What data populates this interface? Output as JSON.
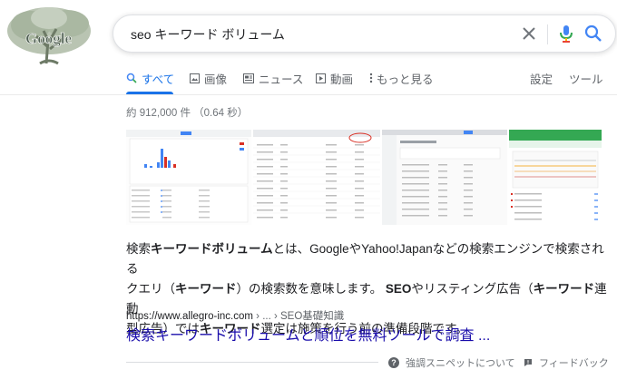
{
  "search": {
    "query": "seo キーワード ボリューム"
  },
  "logo": {
    "text": "Google"
  },
  "tabs": [
    {
      "label": "すべて",
      "icon": "search-icon"
    },
    {
      "label": "画像",
      "icon": "image-icon"
    },
    {
      "label": "ニュース",
      "icon": "news-icon"
    },
    {
      "label": "動画",
      "icon": "video-icon"
    },
    {
      "label": "もっと見る",
      "icon": "more-vert-icon"
    }
  ],
  "right_tabs": {
    "settings": "設定",
    "tools": "ツール"
  },
  "result_stats": "約 912,000 件 （0.64 秒）",
  "snippet_parts": [
    {
      "t": "検索",
      "b": false
    },
    {
      "t": "キーワードボリューム",
      "b": true
    },
    {
      "t": "とは、GoogleやYahoo!Japanなどの検索エンジンで検索される",
      "b": false
    },
    {
      "t": "クエリ（",
      "b": false
    },
    {
      "t": "キーワード",
      "b": true
    },
    {
      "t": "）の検索数を意味します。 ",
      "b": false
    },
    {
      "t": "SEO",
      "b": true
    },
    {
      "t": "やリスティング広告（",
      "b": false
    },
    {
      "t": "キーワード",
      "b": true
    },
    {
      "t": "連動",
      "b": false
    },
    {
      "t": "型広告）では",
      "b": false
    },
    {
      "t": "キーワード",
      "b": true
    },
    {
      "t": "選定は施策を行う前の準備段階です。",
      "b": false
    }
  ],
  "result": {
    "url": "https://www.allegro-inc.com",
    "breadcrumb": " › ... › SEO基礎知識",
    "title": "検索キーワードボリュームと順位を無料ツールで調査 ..."
  },
  "footer": {
    "about": "強調スニペットについて",
    "feedback": "フィードバック"
  },
  "colors": {
    "accent": "#1a73e8",
    "link": "#1a0dab",
    "muted": "#70757a"
  }
}
